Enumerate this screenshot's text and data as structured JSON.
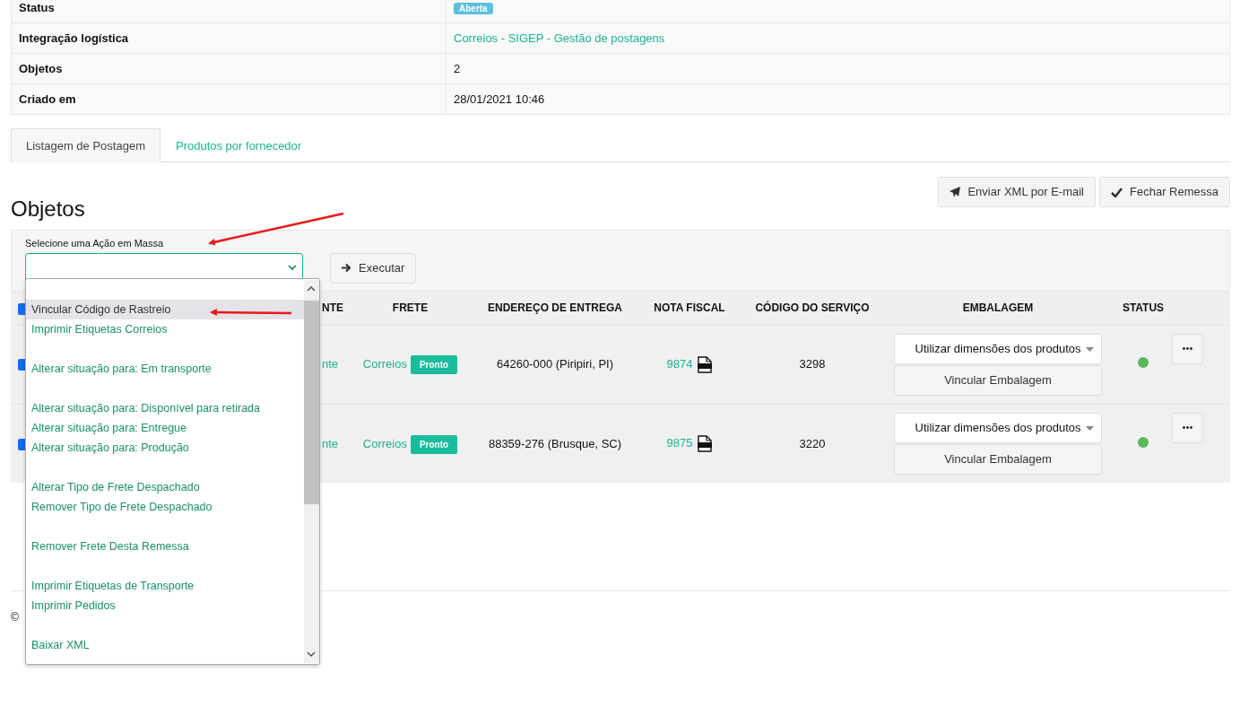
{
  "info_table": {
    "rows": [
      {
        "label": "Status",
        "value": "Aberta",
        "kind": "badge"
      },
      {
        "label": "Integração logística",
        "value": "Correios - SIGEP - Gestão de postagens",
        "kind": "link"
      },
      {
        "label": "Objetos",
        "value": "2",
        "kind": "text"
      },
      {
        "label": "Criado em",
        "value": "28/01/2021 10:46",
        "kind": "text"
      }
    ]
  },
  "tabs": [
    {
      "label": "Listagem de Postagem",
      "selected": true
    },
    {
      "label": "Produtos por fornecedor",
      "selected": false
    }
  ],
  "heading": "Objetos",
  "actions": [
    {
      "label": "Enviar XML por E-mail",
      "kind": "send"
    },
    {
      "label": "Fechar Remessa",
      "kind": "check"
    }
  ],
  "bulk": {
    "label": "Selecione uma Ação em Massa",
    "execute": "Executar",
    "options": [
      {
        "kind": "blank",
        "selected": false
      },
      {
        "kind": "option",
        "label": "Vincular Código de Rastreio",
        "selected": true
      },
      {
        "kind": "option",
        "label": "Imprimir Etiquetas Correios",
        "selected": false
      },
      {
        "kind": "blank",
        "selected": false
      },
      {
        "kind": "option",
        "label": "Alterar situação para: Em transporte",
        "selected": false
      },
      {
        "kind": "blank",
        "selected": false
      },
      {
        "kind": "option",
        "label": "Alterar situação para: Disponível para retirada",
        "selected": false
      },
      {
        "kind": "option",
        "label": "Alterar situação para: Entregue",
        "selected": false
      },
      {
        "kind": "option",
        "label": "Alterar situação para: Produção",
        "selected": false
      },
      {
        "kind": "blank",
        "selected": false
      },
      {
        "kind": "option",
        "label": "Alterar Tipo de Frete Despachado",
        "selected": false
      },
      {
        "kind": "option",
        "label": "Remover Tipo de Frete Despachado",
        "selected": false
      },
      {
        "kind": "blank",
        "selected": false
      },
      {
        "kind": "option",
        "label": "Remover Frete Desta Remessa",
        "selected": false
      },
      {
        "kind": "blank",
        "selected": false
      },
      {
        "kind": "option",
        "label": "Imprimir Etiquetas de Transporte",
        "selected": false
      },
      {
        "kind": "option",
        "label": "Imprimir Pedidos",
        "selected": false
      },
      {
        "kind": "blank",
        "selected": false
      },
      {
        "kind": "option",
        "label": "Baixar XML",
        "selected": false
      }
    ]
  },
  "table": {
    "select_all_checked": true,
    "columns": [
      "NTE",
      "FRETE",
      "ENDEREÇO DE ENTREGA",
      "NOTA FISCAL",
      "CÓDIGO DO SERVIÇO",
      "EMBALAGEM",
      "STATUS"
    ],
    "rows": [
      {
        "checked": true,
        "column_2": "nte",
        "carrier": "Correios",
        "freight_badge": "Pronto",
        "address": "64260-000 (Piripiri, PI)",
        "invoice": "9874",
        "service_code": "3298",
        "packaging": "Utilizar dimensões dos produtos",
        "packaging_button": "Vincular Embalagem",
        "color": "#5cb85c"
      },
      {
        "checked": true,
        "column_2": "nte",
        "carrier": "Correios",
        "freight_badge": "Pronto",
        "address": "88359-276 (Brusque, SC)",
        "invoice": "9875",
        "service_code": "3220",
        "packaging": "Utilizar dimensões dos produtos",
        "packaging_button": "Vincular Embalagem",
        "color": "#5cb85c"
      }
    ]
  },
  "footer": {
    "copyright": "©"
  }
}
